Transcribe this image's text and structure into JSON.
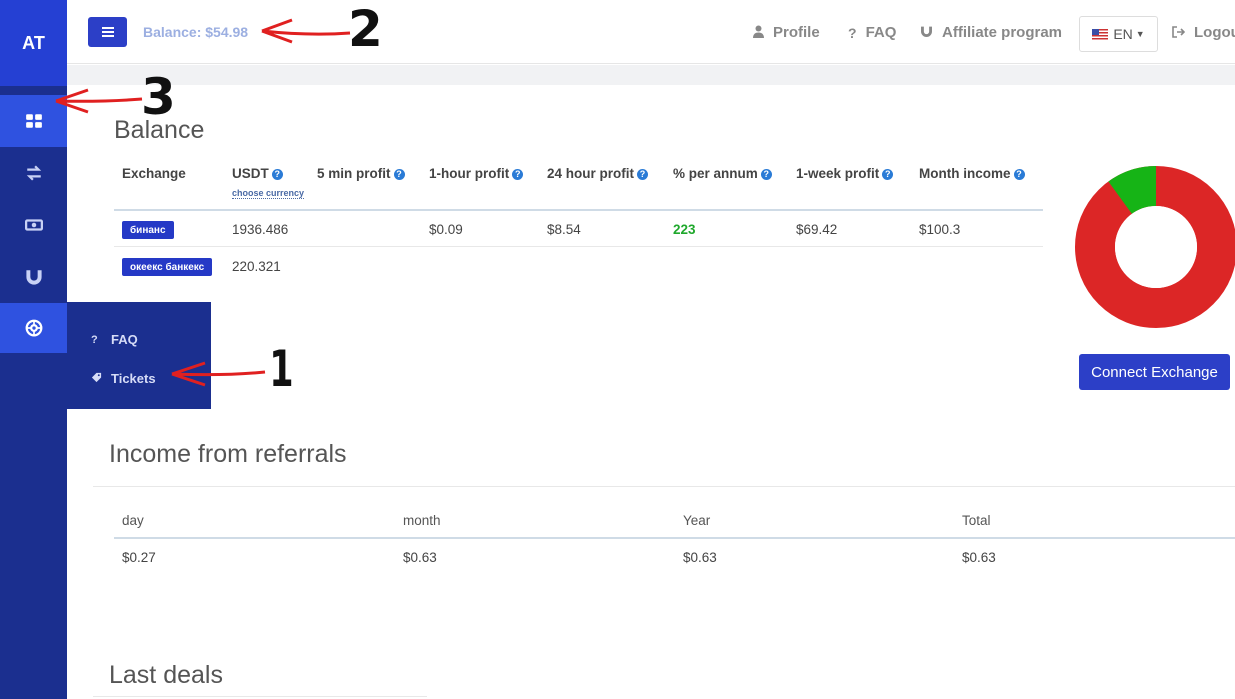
{
  "sidebar": {
    "logo": "AT",
    "items": [
      {
        "name": "dashboard",
        "icon": "grid-icon",
        "active": true
      },
      {
        "name": "transfers",
        "icon": "exchange-arrows-icon",
        "active": false
      },
      {
        "name": "money",
        "icon": "money-icon",
        "active": false
      },
      {
        "name": "affiliate",
        "icon": "magnet-icon",
        "active": false
      },
      {
        "name": "support",
        "icon": "lifebuoy-icon",
        "active": true
      }
    ],
    "submenu": [
      {
        "label": "FAQ",
        "icon": "question-icon"
      },
      {
        "label": "Tickets",
        "icon": "tag-icon"
      }
    ]
  },
  "topbar": {
    "balance": "Balance: $54.98",
    "nav": [
      {
        "label": "Profile",
        "icon": "user-icon"
      },
      {
        "label": "FAQ",
        "icon": "question-icon"
      },
      {
        "label": "Affiliate program",
        "icon": "magnet-icon"
      }
    ],
    "language": "EN",
    "logout": "Logou"
  },
  "balance_section": {
    "title": "Balance",
    "headers": [
      "Exchange",
      "USDT",
      "5 min profit",
      "1-hour profit",
      "24 hour profit",
      "% per annum",
      "1-week profit",
      "Month income"
    ],
    "choose_currency": "choose currency",
    "rows": [
      {
        "exchange": "бинанс",
        "usdt": "1936.486",
        "min5": "",
        "hour1": "$0.09",
        "hour24": "$8.54",
        "annum": "223",
        "week1": "$69.42",
        "month": "$100.3"
      },
      {
        "exchange": "океекс банкекс",
        "usdt": "220.321",
        "min5": "",
        "hour1": "",
        "hour24": "",
        "annum": "",
        "week1": "",
        "month": ""
      }
    ],
    "chart": {
      "slices": [
        {
          "value": 0.9,
          "color": "#dc2626"
        },
        {
          "value": 0.1,
          "color": "#16b416"
        }
      ]
    },
    "connect_button": "Connect Exchange"
  },
  "referrals": {
    "title": "Income from referrals",
    "headers": [
      "day",
      "month",
      "Year",
      "Total"
    ],
    "values": [
      "$0.27",
      "$0.63",
      "$0.63",
      "$0.63"
    ]
  },
  "last_deals": {
    "title": "Last deals"
  },
  "annotations": [
    "1",
    "2",
    "3"
  ],
  "colors": {
    "accent": "#2c3fc7",
    "sidebar": "#1b2f8f",
    "annotation_arrow": "#e02020"
  }
}
